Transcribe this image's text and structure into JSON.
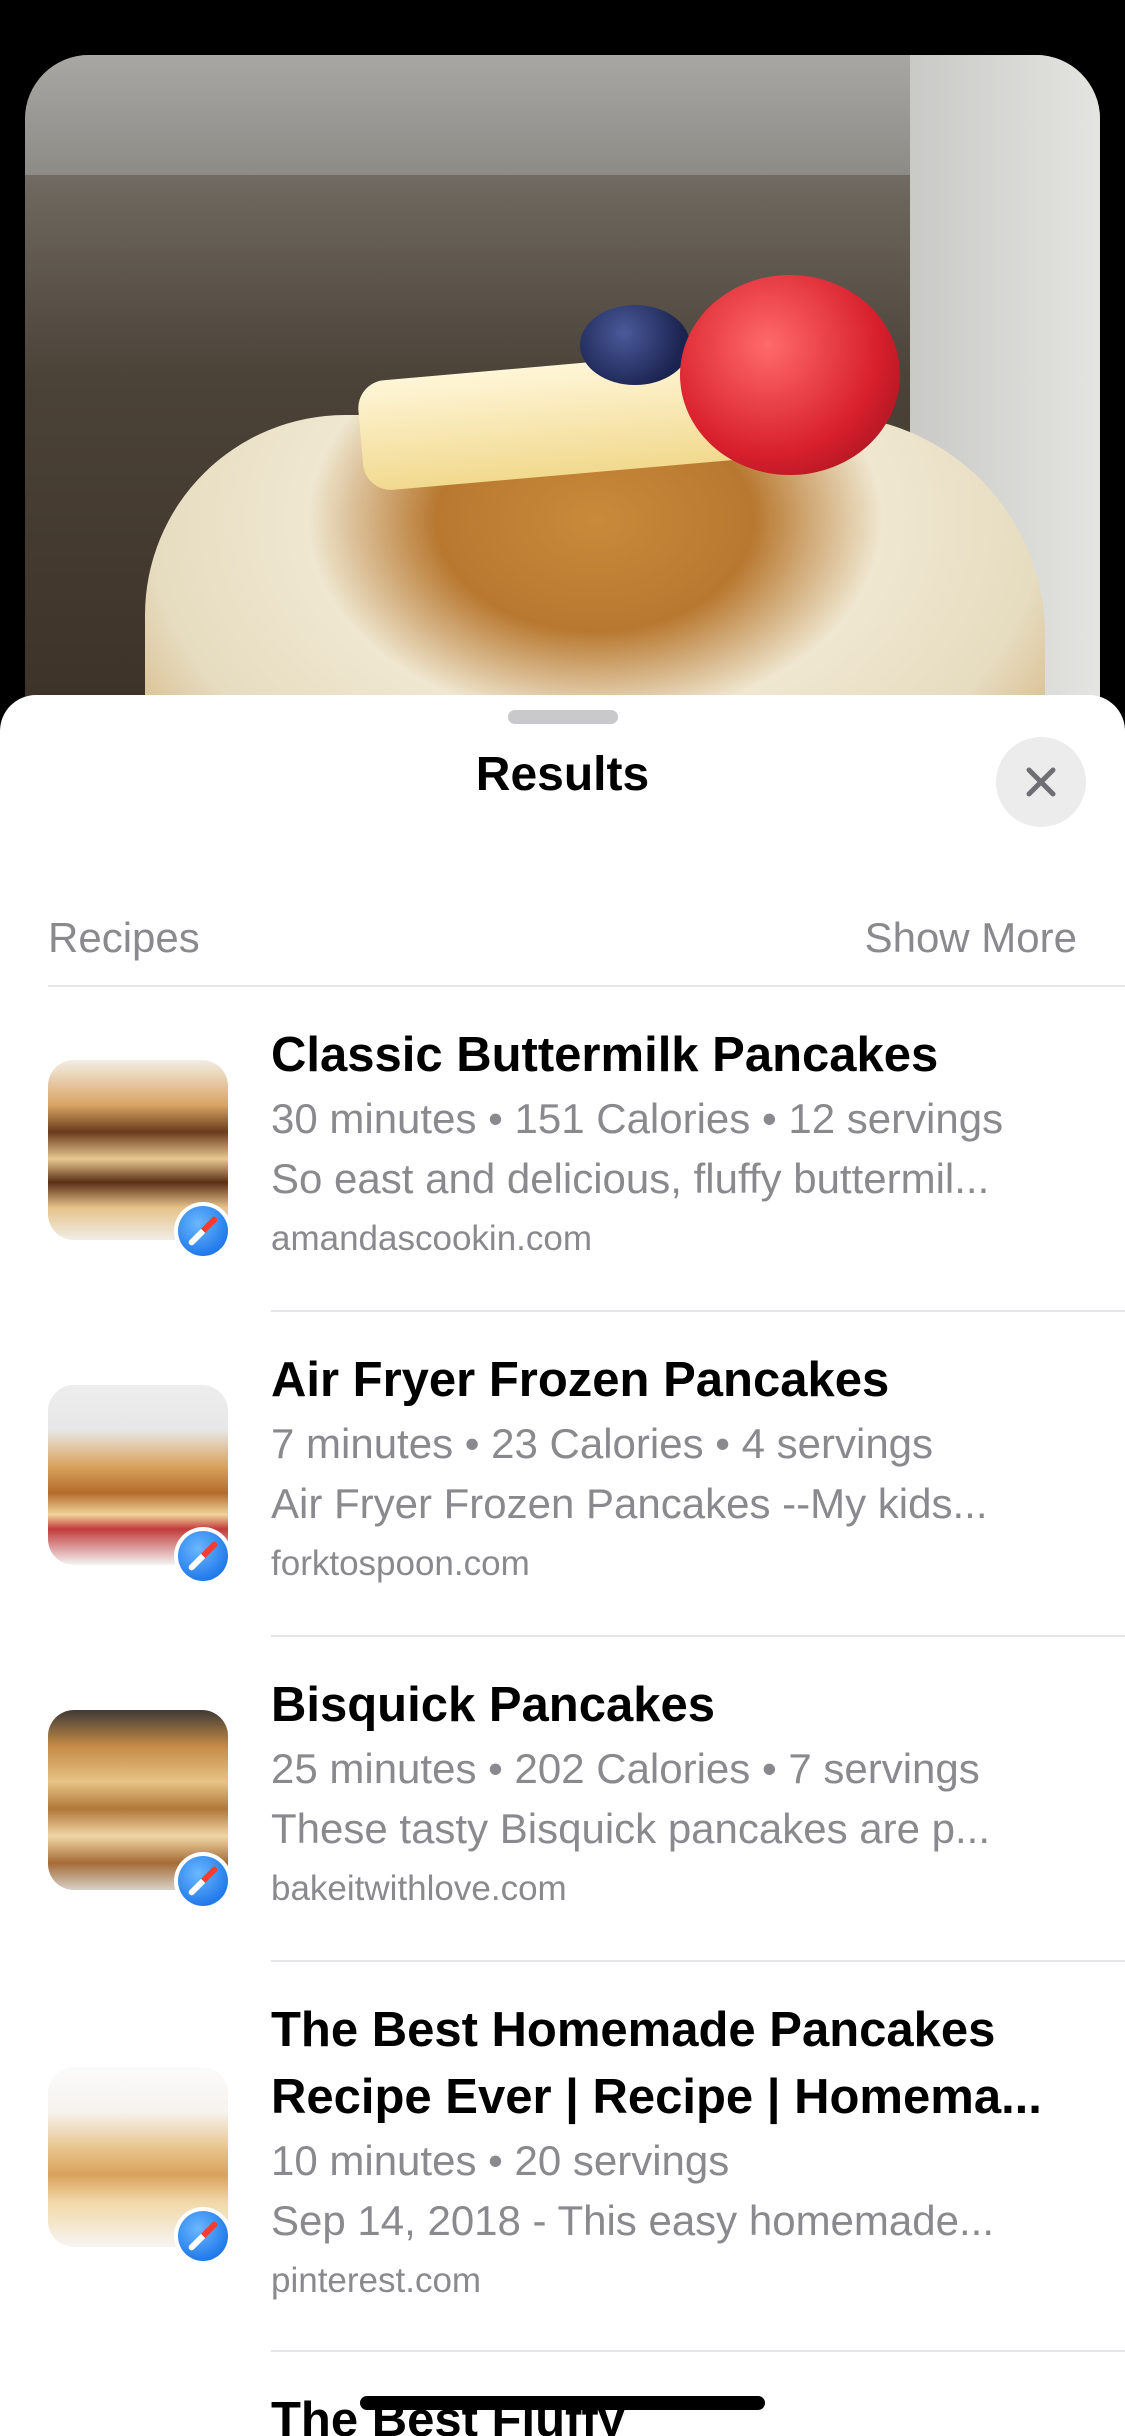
{
  "sheet": {
    "title": "Results",
    "close_icon": "close-icon"
  },
  "section": {
    "label": "Recipes",
    "show_more": "Show More"
  },
  "results": [
    {
      "title_lines": [
        "Classic Buttermilk Pancakes"
      ],
      "meta": "30 minutes • 151 Calories • 12 servings",
      "description": "So east and delicious, fluffy buttermil...",
      "source": "amandascookin.com",
      "thumb_icon": "pancake-stack-thumbnail",
      "badge_icon": "safari-icon"
    },
    {
      "title_lines": [
        "Air Fryer Frozen Pancakes"
      ],
      "meta": "7 minutes • 23 Calories • 4 servings",
      "description": "Air Fryer Frozen Pancakes --My kids...",
      "source": "forktospoon.com",
      "thumb_icon": "pancake-stack-thumbnail",
      "badge_icon": "safari-icon"
    },
    {
      "title_lines": [
        "Bisquick Pancakes"
      ],
      "meta": "25 minutes • 202 Calories • 7 servings",
      "description": "These tasty Bisquick pancakes are p...",
      "source": "bakeitwithlove.com",
      "thumb_icon": "pancake-stack-thumbnail",
      "badge_icon": "safari-icon"
    },
    {
      "title_lines": [
        "The Best Homemade Pancakes",
        "Recipe Ever | Recipe | Homema..."
      ],
      "meta": "10 minutes • 20 servings",
      "description": "Sep 14, 2018 - This easy homemade...",
      "source": "pinterest.com",
      "thumb_icon": "pancake-stack-thumbnail",
      "badge_icon": "safari-icon"
    },
    {
      "title_lines": [
        "The Best Fluffy"
      ]
    }
  ]
}
